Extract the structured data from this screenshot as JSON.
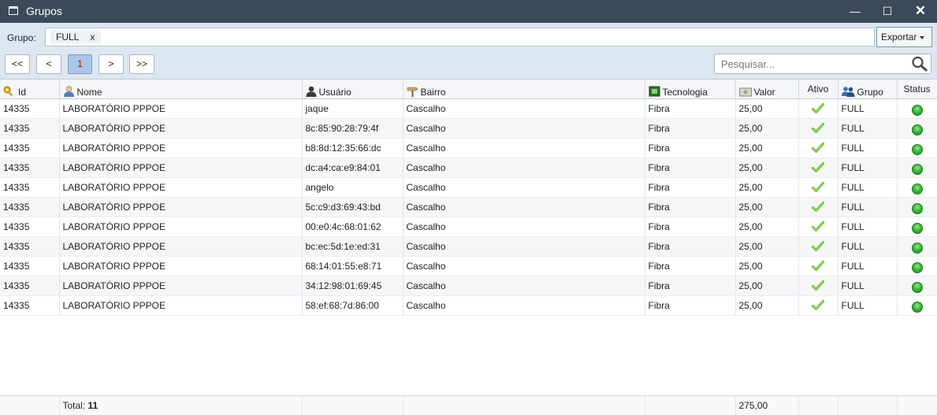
{
  "window": {
    "title": "Grupos",
    "minimize": "—",
    "maximize": "☐",
    "close": "✕"
  },
  "filter": {
    "label": "Grupo:",
    "tag": "FULL",
    "tag_remove": "x",
    "export_label": "Exportar"
  },
  "pager": {
    "first": "<<",
    "prev": "<",
    "current": "1",
    "next": ">",
    "last": ">>"
  },
  "search": {
    "placeholder": "Pesquisar..."
  },
  "columns": {
    "id": "Id",
    "nome": "Nome",
    "usuario": "Usuário",
    "bairro": "Bairro",
    "tecnologia": "Tecnologia",
    "valor": "Valor",
    "ativo": "Ativo",
    "grupo": "Grupo",
    "status": "Status"
  },
  "rows": [
    {
      "id": "14335",
      "nome": "LABORATÓRIO PPPOE",
      "usuario": "jaque",
      "bairro": "Cascalho",
      "tecnologia": "Fibra",
      "valor": "25,00",
      "ativo": true,
      "grupo": "FULL",
      "status": "online"
    },
    {
      "id": "14335",
      "nome": "LABORATÓRIO PPPOE",
      "usuario": "8c:85:90:28:79:4f",
      "bairro": "Cascalho",
      "tecnologia": "Fibra",
      "valor": "25,00",
      "ativo": true,
      "grupo": "FULL",
      "status": "online"
    },
    {
      "id": "14335",
      "nome": "LABORATÓRIO PPPOE",
      "usuario": "b8:8d:12:35:66:dc",
      "bairro": "Cascalho",
      "tecnologia": "Fibra",
      "valor": "25,00",
      "ativo": true,
      "grupo": "FULL",
      "status": "online"
    },
    {
      "id": "14335",
      "nome": "LABORATÓRIO PPPOE",
      "usuario": "dc:a4:ca:e9:84:01",
      "bairro": "Cascalho",
      "tecnologia": "Fibra",
      "valor": "25,00",
      "ativo": true,
      "grupo": "FULL",
      "status": "online"
    },
    {
      "id": "14335",
      "nome": "LABORATÓRIO PPPOE",
      "usuario": "angelo",
      "bairro": "Cascalho",
      "tecnologia": "Fibra",
      "valor": "25,00",
      "ativo": true,
      "grupo": "FULL",
      "status": "online"
    },
    {
      "id": "14335",
      "nome": "LABORATÓRIO PPPOE",
      "usuario": "5c:c9:d3:69:43:bd",
      "bairro": "Cascalho",
      "tecnologia": "Fibra",
      "valor": "25,00",
      "ativo": true,
      "grupo": "FULL",
      "status": "online"
    },
    {
      "id": "14335",
      "nome": "LABORATÓRIO PPPOE",
      "usuario": "00:e0:4c:68:01:62",
      "bairro": "Cascalho",
      "tecnologia": "Fibra",
      "valor": "25,00",
      "ativo": true,
      "grupo": "FULL",
      "status": "online"
    },
    {
      "id": "14335",
      "nome": "LABORATÓRIO PPPOE",
      "usuario": "bc:ec:5d:1e:ed:31",
      "bairro": "Cascalho",
      "tecnologia": "Fibra",
      "valor": "25,00",
      "ativo": true,
      "grupo": "FULL",
      "status": "online"
    },
    {
      "id": "14335",
      "nome": "LABORATÓRIO PPPOE",
      "usuario": "68:14:01:55:e8:71",
      "bairro": "Cascalho",
      "tecnologia": "Fibra",
      "valor": "25,00",
      "ativo": true,
      "grupo": "FULL",
      "status": "online"
    },
    {
      "id": "14335",
      "nome": "LABORATÓRIO PPPOE",
      "usuario": "34:12:98:01:69:45",
      "bairro": "Cascalho",
      "tecnologia": "Fibra",
      "valor": "25,00",
      "ativo": true,
      "grupo": "FULL",
      "status": "online"
    },
    {
      "id": "14335",
      "nome": "LABORATÓRIO PPPOE",
      "usuario": "58:ef:68:7d:86:00",
      "bairro": "Cascalho",
      "tecnologia": "Fibra",
      "valor": "25,00",
      "ativo": true,
      "grupo": "FULL",
      "status": "online"
    }
  ],
  "footer": {
    "total_label": "Total:",
    "total_count": "11",
    "valor_total": "275,00"
  },
  "colors": {
    "titlebar": "#3b4a5a",
    "toolbar": "#dce7f2",
    "active_page": "#a7c6e6",
    "status_online": "#3cb93c",
    "check": "#5cb82a"
  },
  "icons": {
    "id": "key-icon",
    "nome": "user-icon",
    "usuario": "person-icon",
    "bairro": "signpost-icon",
    "tecnologia": "chip-icon",
    "valor": "money-icon",
    "grupo": "group-icon",
    "ativo": "check-icon",
    "status": "status-dot-icon",
    "search": "search-icon"
  }
}
